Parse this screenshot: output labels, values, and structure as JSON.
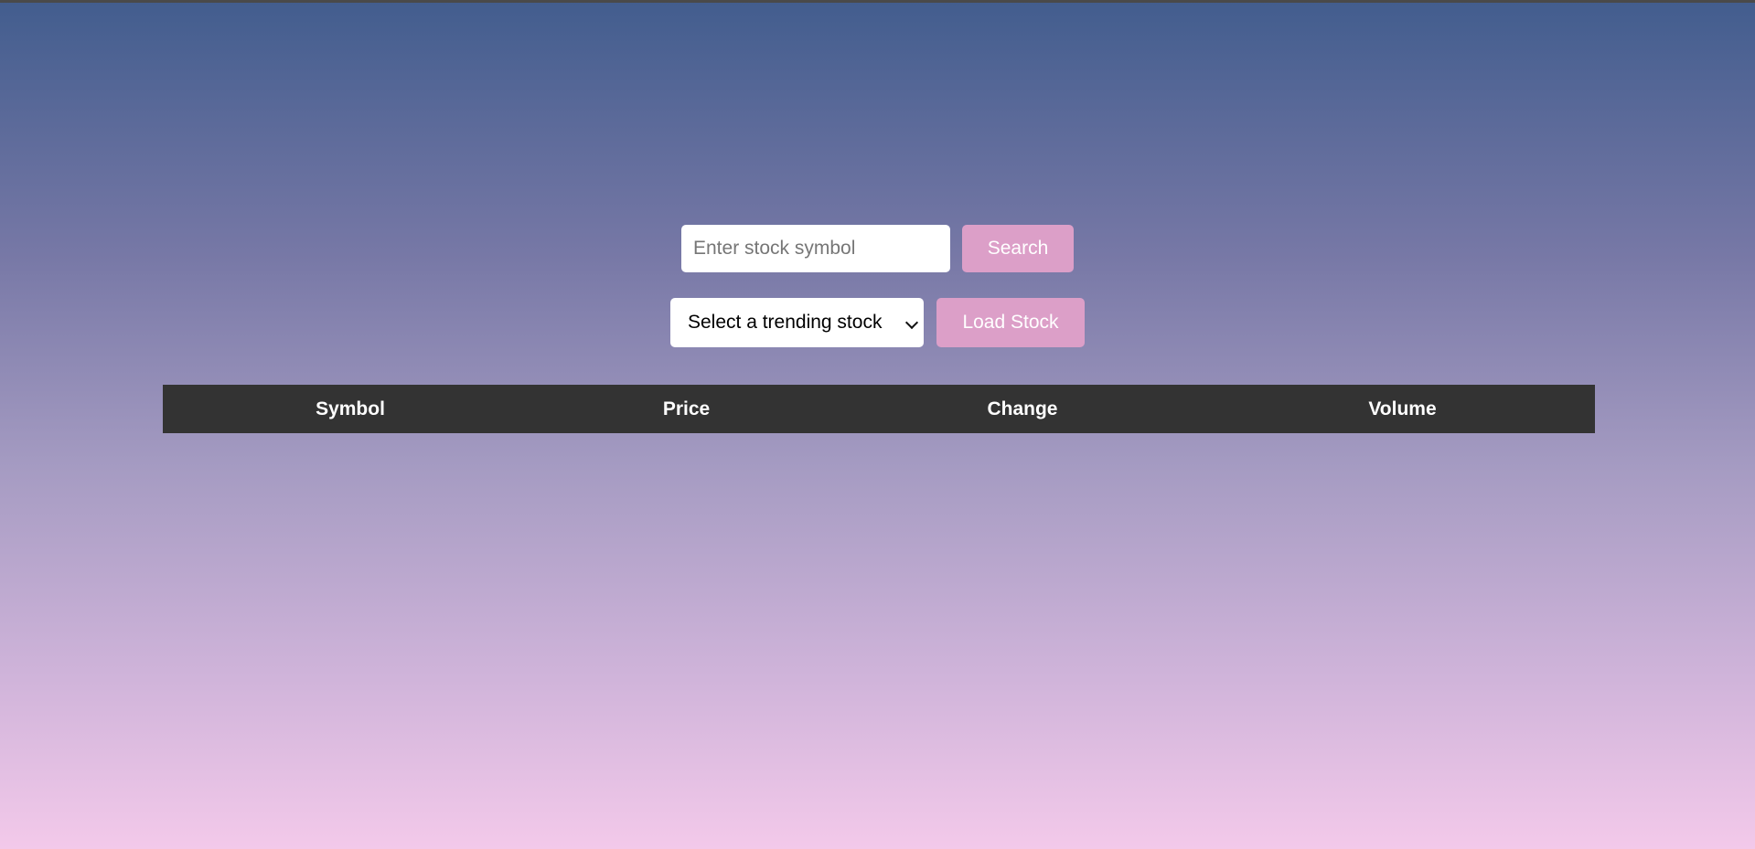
{
  "search": {
    "placeholder": "Enter stock symbol",
    "value": "",
    "button_label": "Search"
  },
  "trending": {
    "selected_option": "Select a trending stock",
    "button_label": "Load Stock"
  },
  "table": {
    "columns": [
      "Symbol",
      "Price",
      "Change",
      "Volume"
    ],
    "rows": []
  },
  "colors": {
    "gradient_top": "#425d8e",
    "gradient_bottom": "#f3c9ea",
    "button_bg": "#dc9fc8",
    "table_header_bg": "#333333"
  },
  "icons": {
    "select_arrow": "chevron-down-icon"
  }
}
